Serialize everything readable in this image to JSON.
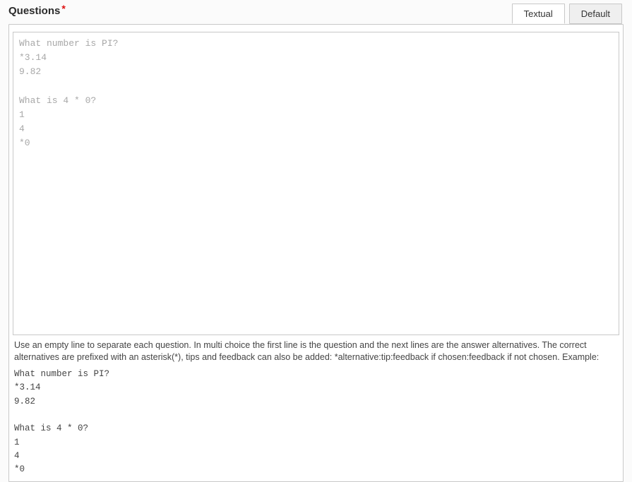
{
  "section": {
    "title": "Questions",
    "required_mark": "*"
  },
  "tabs": {
    "textual": "Textual",
    "default": "Default"
  },
  "editor": {
    "value": "",
    "placeholder": "What number is PI?\n*3.14\n9.82\n\nWhat is 4 * 0?\n1\n4\n*0"
  },
  "help": {
    "intro": "Use an empty line to separate each question. In multi choice the first line is the question and the next lines are the answer alternatives. The correct alternatives are prefixed with an asterisk(*), tips and feedback can also be added: *alternative:tip:feedback if chosen:feedback if not chosen. Example:",
    "example": "What number is PI?\n*3.14\n9.82\n\nWhat is 4 * 0?\n1\n4\n*0"
  }
}
